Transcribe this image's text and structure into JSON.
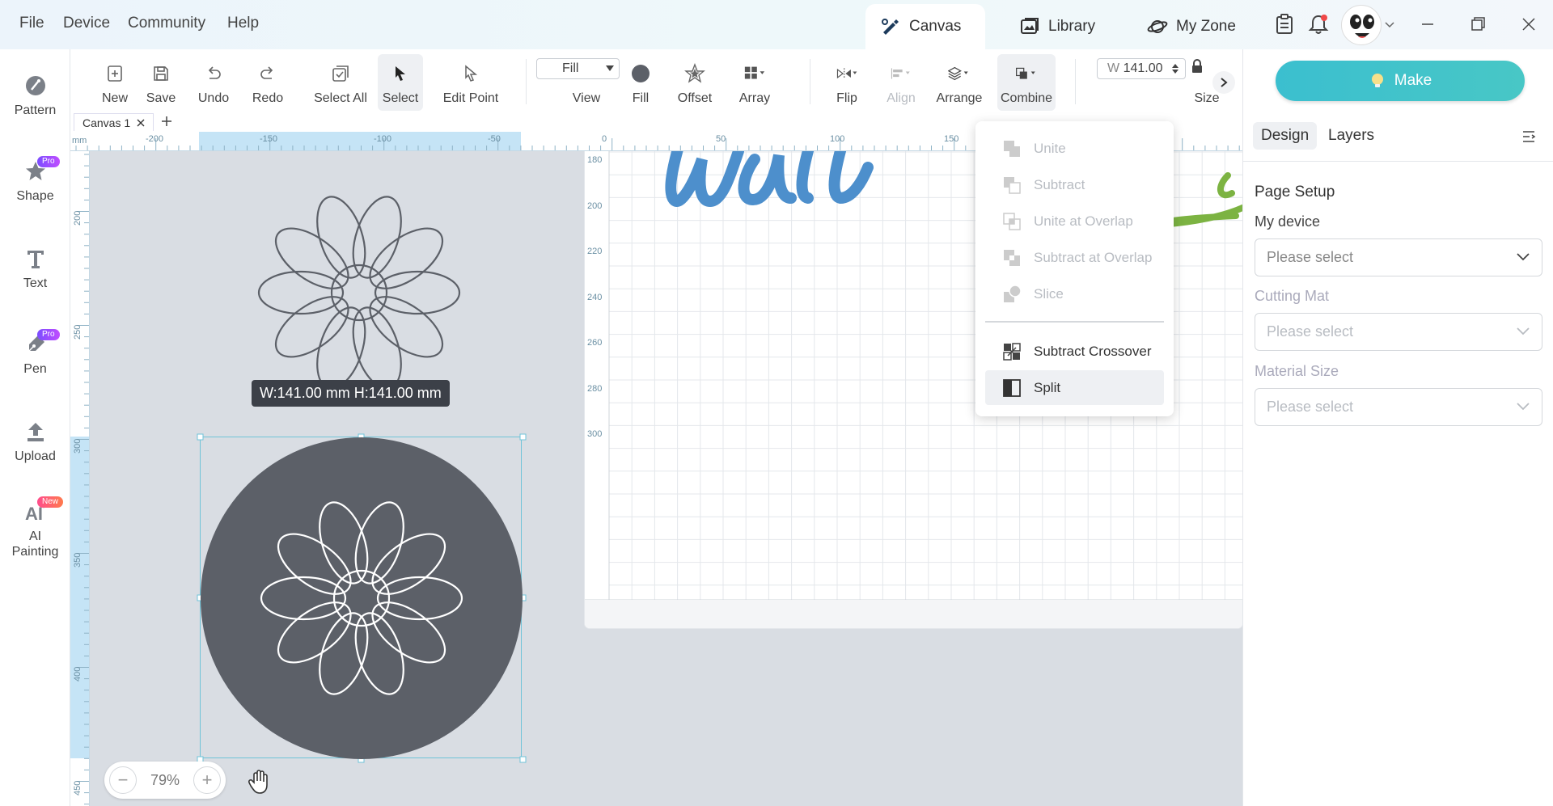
{
  "menu": {
    "file": "File",
    "device": "Device",
    "community": "Community",
    "help": "Help"
  },
  "tabs": {
    "canvas": "Canvas",
    "library": "Library",
    "myzone": "My Zone"
  },
  "toolbar": {
    "new": "New",
    "save": "Save",
    "undo": "Undo",
    "redo": "Redo",
    "select_all": "Select All",
    "select": "Select",
    "edit_point": "Edit Point",
    "fill_value": "Fill",
    "view": "View",
    "fill": "Fill",
    "offset": "Offset",
    "array": "Array",
    "flip": "Flip",
    "align": "Align",
    "arrange": "Arrange",
    "combine": "Combine",
    "width_prefix": "W",
    "width_value": "141.00",
    "size": "Size"
  },
  "sidebar": {
    "pattern": "Pattern",
    "shape": "Shape",
    "text": "Text",
    "pen": "Pen",
    "upload": "Upload",
    "ai_line1": "AI",
    "ai_line2": "Painting",
    "pro": "Pro",
    "new": "New"
  },
  "canvas": {
    "tab_name": "Canvas 1",
    "unit": "mm",
    "hruler_labels": [
      "-200",
      "-150",
      "-100",
      "-50",
      "0",
      "50",
      "100",
      "150",
      "50"
    ],
    "vruler_labels": [
      "200",
      "250",
      "300",
      "350",
      "400",
      "450"
    ],
    "mat_row_labels": [
      "180",
      "200",
      "220",
      "240",
      "260",
      "280",
      "300"
    ],
    "dimensions": "W:141.00 mm  H:141.00 mm",
    "zoom": "79%",
    "zoom_minus": "−",
    "zoom_plus": "+"
  },
  "combine_menu": {
    "unite": "Unite",
    "subtract": "Subtract",
    "unite_overlap": "Unite at Overlap",
    "subtract_overlap": "Subtract at Overlap",
    "slice": "Slice",
    "subtract_crossover": "Subtract Crossover",
    "split": "Split"
  },
  "panel": {
    "make": "Make",
    "design": "Design",
    "layers": "Layers",
    "page_setup": "Page Setup",
    "my_device": "My device",
    "cutting_mat": "Cutting Mat",
    "material_size": "Material Size",
    "placeholder": "Please select"
  },
  "colors": {
    "accent": "#3bbfcf",
    "shape_fill": "#5c6068",
    "script_blue": "#4d8fcc",
    "script_green": "#7cb342",
    "ruler_highlight": "#c5e4f6"
  }
}
